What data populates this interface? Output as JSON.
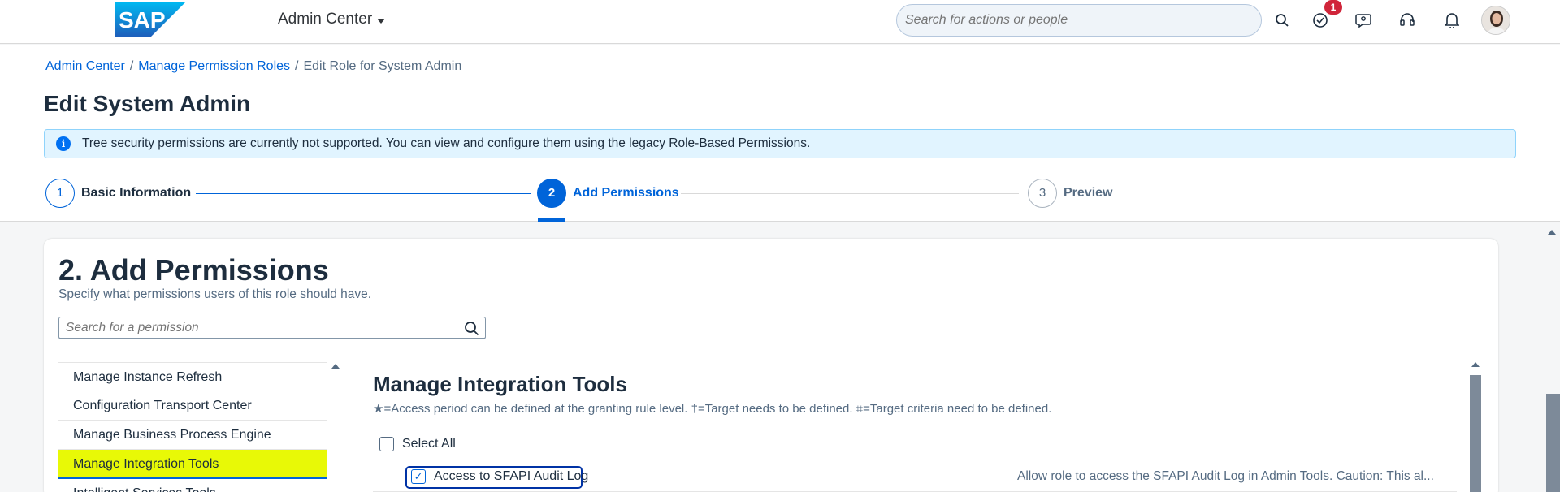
{
  "shell": {
    "logo_text": "SAP",
    "app_title": "Admin Center",
    "search_placeholder": "Search for actions or people",
    "todo_badge": "1",
    "icons": [
      "search-icon",
      "todo-icon",
      "ask-icon",
      "support-icon",
      "bell-icon",
      "avatar"
    ]
  },
  "breadcrumb": {
    "items": [
      "Admin Center",
      "Manage Permission Roles"
    ],
    "separator": "/",
    "current": "Edit Role for System Admin"
  },
  "page": {
    "title": "Edit System Admin",
    "info_message": "Tree security permissions are currently not supported. You can view and configure them using the legacy Role-Based Permissions."
  },
  "steps": [
    {
      "number": "1",
      "label": "Basic Information",
      "state": "done"
    },
    {
      "number": "2",
      "label": "Add Permissions",
      "state": "active"
    },
    {
      "number": "3",
      "label": "Preview",
      "state": "future"
    }
  ],
  "section": {
    "title": "2. Add Permissions",
    "subtitle": "Specify what permissions users of this role should have.",
    "search_placeholder": "Search for a permission"
  },
  "categories": [
    {
      "label": "Manage Instance Refresh",
      "selected": false
    },
    {
      "label": "Configuration Transport Center",
      "selected": false
    },
    {
      "label": "Manage Business Process Engine",
      "selected": false
    },
    {
      "label": "Manage Integration Tools",
      "selected": true
    },
    {
      "label": "Intelligent Services Tools",
      "selected": false
    }
  ],
  "detail": {
    "title": "Manage Integration Tools",
    "legend": "★=Access period can be defined at the granting rule level.   †=Target needs to be defined.   ⌗=Target criteria need to be defined.",
    "select_all_label": "Select All",
    "permissions": [
      {
        "label": "Access to SFAPI Audit Log",
        "checked": true,
        "description": "Allow role to access the SFAPI Audit Log in Admin Tools. Caution: This al..."
      }
    ]
  },
  "colors": {
    "brand_blue": "#0064d9",
    "highlight_yellow": "#e8f906",
    "info_bg": "#e1f4ff",
    "badge_red": "#d0253a"
  }
}
